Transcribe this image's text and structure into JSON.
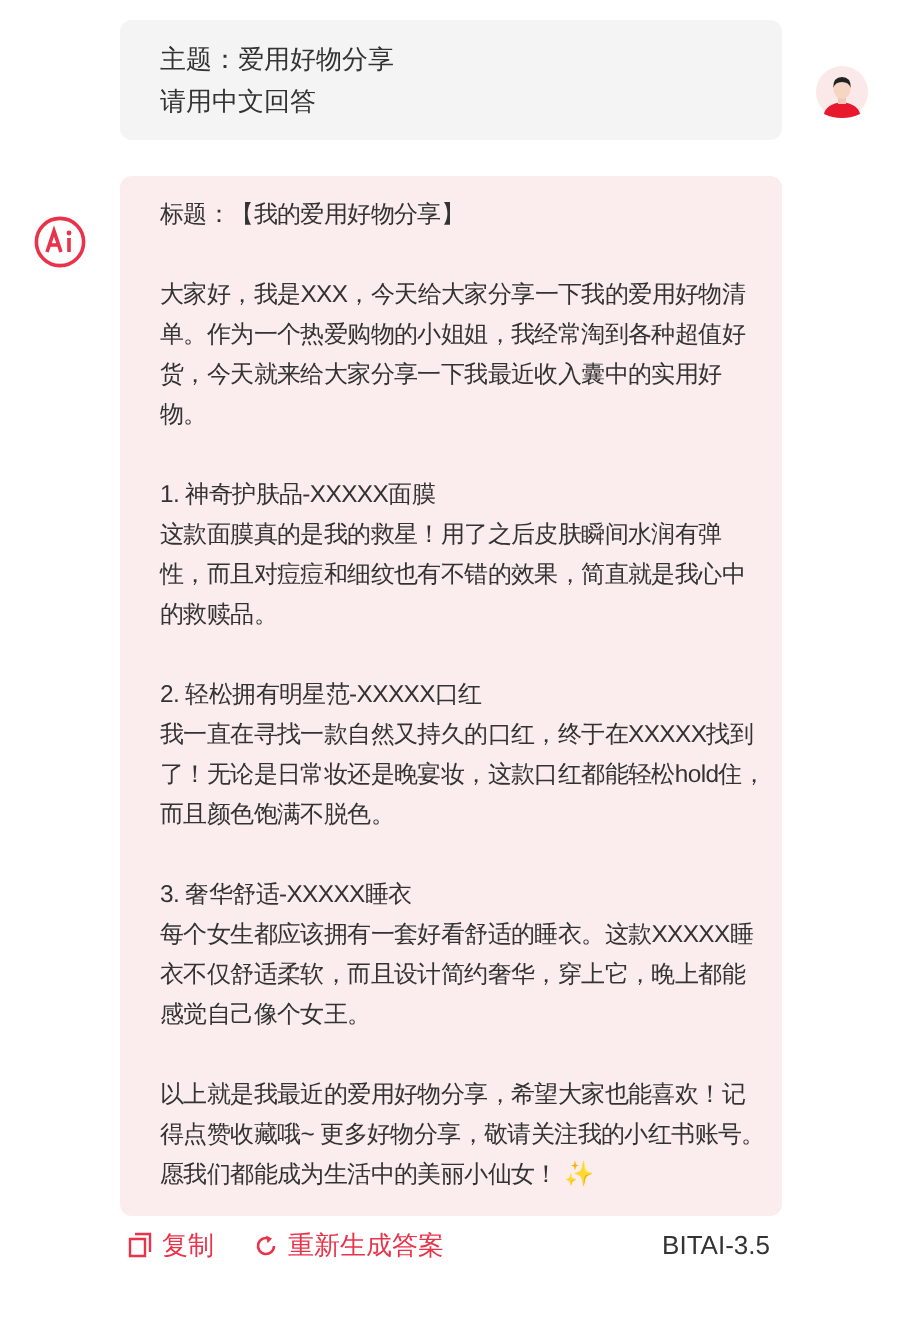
{
  "user_message": {
    "lines": [
      "主题：爱用好物分享",
      "请用中文回答"
    ]
  },
  "ai_message": {
    "title": "标题：【我的爱用好物分享】",
    "paragraphs": [
      {
        "kind": "text",
        "text": "大家好，我是XXX，今天给大家分享一下我的爱用好物清单。作为一个热爱购物的小姐姐，我经常淘到各种超值好货，今天就来给大家分享一下我最近收入囊中的实用好物。"
      },
      {
        "kind": "item",
        "heading": "1. 神奇护肤品-XXXXX面膜",
        "text": "这款面膜真的是我的救星！用了之后皮肤瞬间水润有弹性，而且对痘痘和细纹也有不错的效果，简直就是我心中的救赎品。"
      },
      {
        "kind": "item",
        "heading": "2. 轻松拥有明星范-XXXXX口红",
        "text": "我一直在寻找一款自然又持久的口红，终于在XXXXX找到了！无论是日常妆还是晚宴妆，这款口红都能轻松hold住，而且颜色饱满不脱色。"
      },
      {
        "kind": "item",
        "heading": "3. 奢华舒适-XXXXX睡衣",
        "text": "每个女生都应该拥有一套好看舒适的睡衣。这款XXXXX睡衣不仅舒适柔软，而且设计简约奢华，穿上它，晚上都能感觉自己像个女王。"
      },
      {
        "kind": "text",
        "text": "以上就是我最近的爱用好物分享，希望大家也能喜欢！记得点赞收藏哦~ 更多好物分享，敬请关注我的小红书账号。愿我们都能成为生活中的美丽小仙女！ ✨"
      }
    ]
  },
  "actions": [
    {
      "kind": "copy",
      "label": "复制"
    },
    {
      "kind": "regenerate",
      "label": "重新生成答案"
    }
  ],
  "model": "BITAI-3.5"
}
